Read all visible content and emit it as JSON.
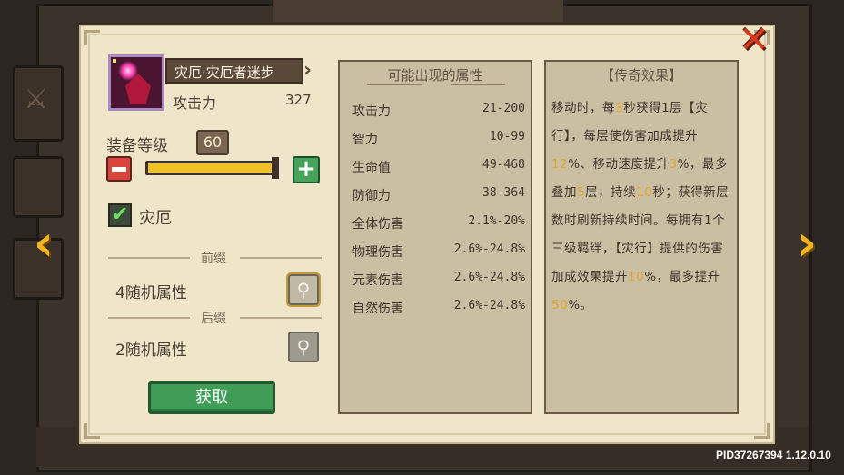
{
  "item": {
    "name": "灾厄·灾厄者迷步",
    "stat_label": "攻击力",
    "stat_value": "327",
    "rarity_color": "#a98ac0"
  },
  "level": {
    "label": "装备等级",
    "value": "60",
    "fraction": 1.0
  },
  "checkbox": {
    "label": "灾厄",
    "checked": true
  },
  "prefix": {
    "title": "前缀",
    "text": "4随机属性"
  },
  "suffix": {
    "title": "后缀",
    "text": "2随机属性"
  },
  "obtain_button": "获取",
  "attributes": {
    "title": "可能出现的属性",
    "rows": [
      {
        "name": "攻击力",
        "range": "21-200"
      },
      {
        "name": "智力",
        "range": "10-99"
      },
      {
        "name": "生命值",
        "range": "49-468"
      },
      {
        "name": "防御力",
        "range": "38-364"
      },
      {
        "name": "全体伤害",
        "range": "2.1%-20%"
      },
      {
        "name": "物理伤害",
        "range": "2.6%-24.8%"
      },
      {
        "name": "元素伤害",
        "range": "2.6%-24.8%"
      },
      {
        "name": "自然伤害",
        "range": "2.6%-24.8%"
      }
    ]
  },
  "legendary": {
    "title": "【传奇效果】",
    "text_parts": [
      {
        "t": "移动时，每",
        "hl": false
      },
      {
        "t": "3",
        "hl": true
      },
      {
        "t": "秒获得1层【灾行】，每层使伤害加成提升",
        "hl": false
      },
      {
        "t": "12",
        "hl": true
      },
      {
        "t": "%、移动速度提升",
        "hl": false
      },
      {
        "t": "3",
        "hl": true
      },
      {
        "t": "%，最多叠加",
        "hl": false
      },
      {
        "t": "5",
        "hl": true
      },
      {
        "t": "层，持续",
        "hl": false
      },
      {
        "t": "10",
        "hl": true
      },
      {
        "t": "秒；获得新层数时刷新持续时间。每拥有1个三级羁绊，【灾行】提供的伤害加成效果提升",
        "hl": false
      },
      {
        "t": "10",
        "hl": true
      },
      {
        "t": "%，最多提升",
        "hl": false
      },
      {
        "t": "50",
        "hl": true
      },
      {
        "t": "%。",
        "hl": false
      }
    ],
    "highlight_color": "#e2a52a"
  },
  "pid": "PID37267394 1.12.0.10",
  "icons": {
    "close": "close-icon",
    "nav_left": "chevron-left-icon",
    "nav_right": "chevron-right-icon",
    "minus": "minus-icon",
    "plus": "plus-icon",
    "magnify": "magnify-icon",
    "check": "check-icon"
  }
}
